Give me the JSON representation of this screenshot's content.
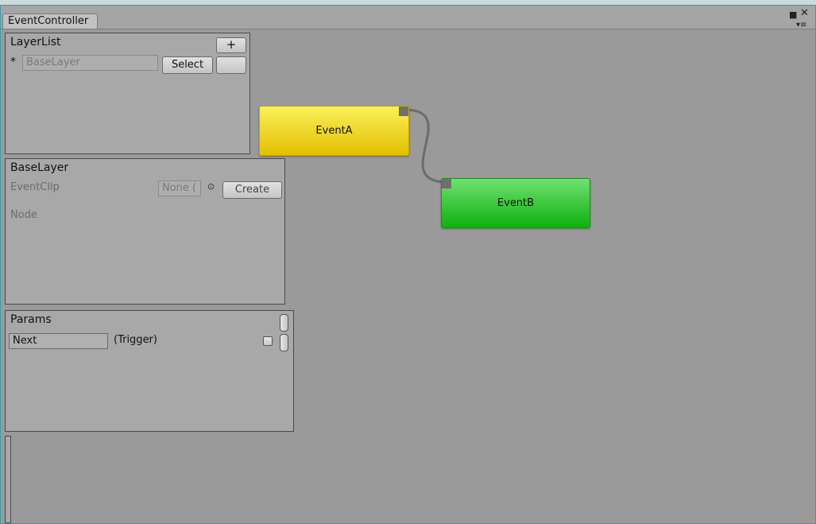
{
  "window": {
    "tab_label": "EventController"
  },
  "layer_list": {
    "title": "LayerList",
    "add_label": "+",
    "marker": "*",
    "layer_name": "BaseLayer",
    "select_label": "Select"
  },
  "base_layer": {
    "title": "BaseLayer",
    "event_clip_label": "EventClip",
    "event_clip_value": "None (",
    "create_label": "Create",
    "node_label": "Node"
  },
  "params": {
    "title": "Params",
    "param_name": "Next",
    "param_type": "(Trigger)"
  },
  "nodes": [
    {
      "label": "EventA",
      "color": "#f3cf1a"
    },
    {
      "label": "EventB",
      "color": "#22c422"
    }
  ],
  "colors": {
    "canvas": "#9a9a9a",
    "panel": "#a8a8a8",
    "edge": "#6c6c6c",
    "frame": "#3b9aa8"
  }
}
